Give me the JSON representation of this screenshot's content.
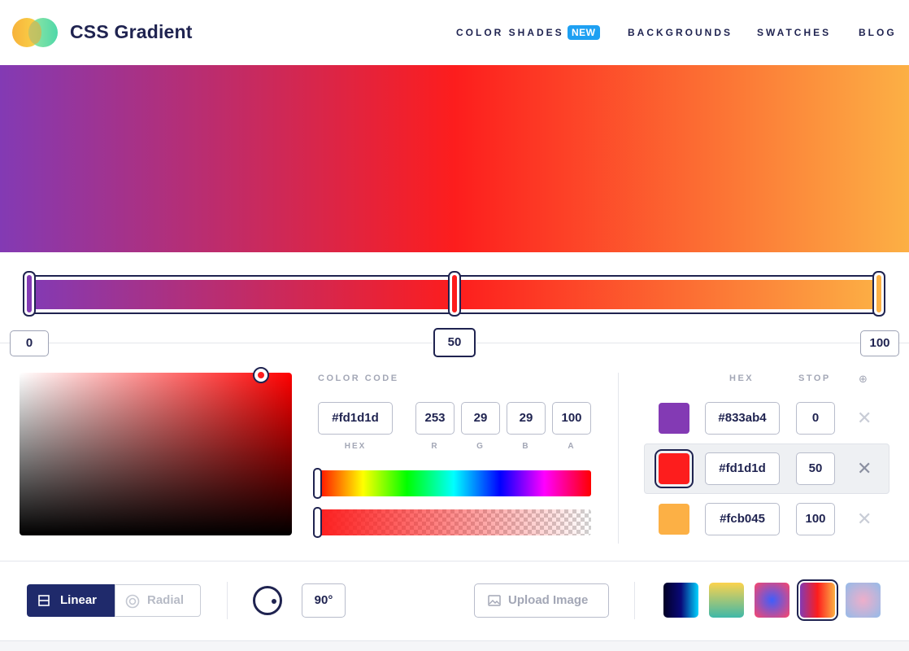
{
  "header": {
    "brand": "CSS Gradient",
    "nav": {
      "color_shades": "COLOR SHADES",
      "new_badge": "NEW",
      "backgrounds": "BACKGROUNDS",
      "swatches": "SWATCHES",
      "blog": "BLOG"
    }
  },
  "gradient": {
    "type": "linear",
    "angle_deg": 90,
    "stops": [
      {
        "hex": "#833ab4",
        "stop": "0"
      },
      {
        "hex": "#fd1d1d",
        "stop": "50"
      },
      {
        "hex": "#fcb045",
        "stop": "100"
      }
    ],
    "selected_stop_index": 1
  },
  "picker": {
    "color_code_label": "COLOR CODE",
    "hex_value": "#fd1d1d",
    "r": "253",
    "g": "29",
    "b": "29",
    "a": "100",
    "labels": {
      "hex": "HEX",
      "r": "R",
      "g": "G",
      "b": "B",
      "a": "A"
    }
  },
  "stops_list": {
    "hex_header": "HEX",
    "stop_header": "STOP",
    "add_icon": "⊕",
    "remove_icon": "✕"
  },
  "toolbar": {
    "linear_label": "Linear",
    "radial_label": "Radial",
    "angle_value": "90°",
    "upload_label": "Upload Image"
  },
  "presets": [
    {
      "colors": [
        "#020024",
        "#090979",
        "#00d4ff"
      ]
    },
    {
      "colors": [
        "#fcd34d",
        "#3fb8a8"
      ]
    },
    {
      "colors": [
        "#3f5efb",
        "#fc466b"
      ]
    },
    {
      "colors": [
        "#833ab4",
        "#fd1d1d",
        "#fcb045"
      ],
      "selected": true
    },
    {
      "colors": [
        "#eeaeca",
        "#94bbe9"
      ]
    }
  ]
}
